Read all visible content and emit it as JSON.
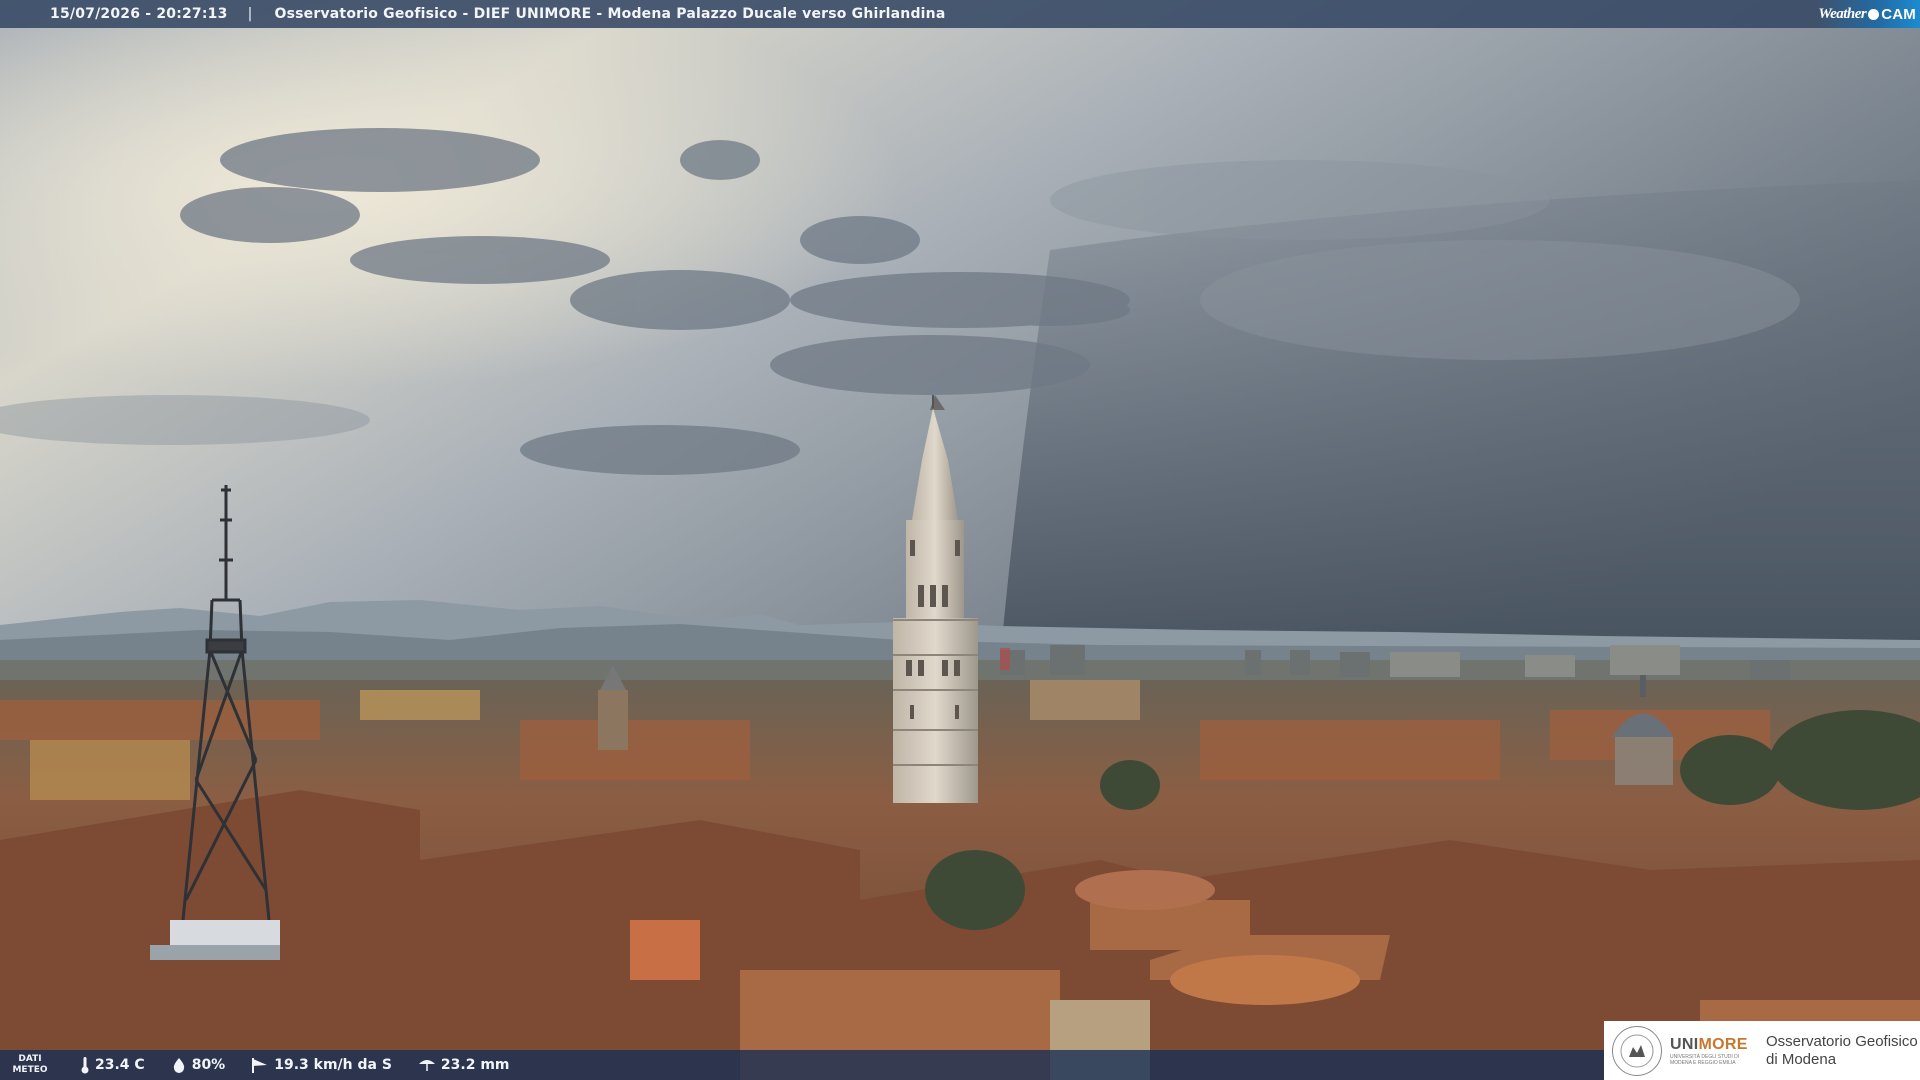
{
  "header": {
    "datetime": "15/07/2026 - 20:27:13",
    "separator": "|",
    "camera_title": "Osservatorio Geofisico - DIEF UNIMORE - Modena Palazzo Ducale verso Ghirlandina",
    "brand_weather": "Weather",
    "brand_cam": "CAM"
  },
  "weather": {
    "label_line1": "DATI",
    "label_line2": "METEO",
    "temperature": "23.4 C",
    "humidity": "80%",
    "wind": "19.3 km/h da S",
    "rain": "23.2 mm"
  },
  "logo": {
    "uni_part1": "UNI",
    "uni_part2": "MORE",
    "uni_subtitle": "UNIVERSITÀ DEGLI STUDI DI MODENA E REGGIO EMILIA",
    "observatory_line1": "Osservatorio Geofisico",
    "observatory_line2": "di Modena"
  },
  "colors": {
    "sky_top": "#9aa3ad",
    "sky_bright": "#e4e2d6",
    "storm": "#4a5563",
    "roofs": "#8a5a3e",
    "bar": "#364864"
  }
}
